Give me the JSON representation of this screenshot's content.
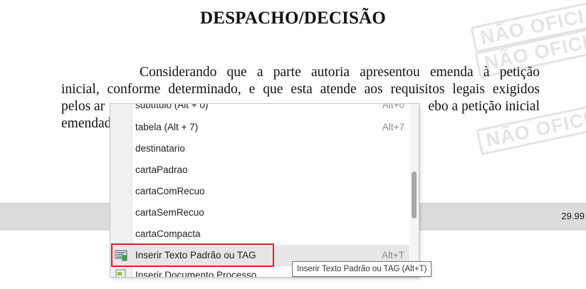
{
  "document": {
    "title": "DESPACHO/DECISÃO",
    "line1": "Considerando que a parte autoria apresentou emenda à petição",
    "line2": "inicial, conforme determinado, e que esta atende aos  requisitos legais exigidos",
    "line3_start": "pelos ar",
    "line3_end": "ebo a petição inicial",
    "line4_start": "emendad",
    "watermark": "NÃO OFICIAL"
  },
  "statusbar": {
    "zoom": "29.99"
  },
  "context_menu": {
    "items": [
      {
        "label": "subtítulo (Alt + 0)",
        "shortcut": "Alt+0"
      },
      {
        "label": "tabela (Alt + 7)",
        "shortcut": "Alt+7"
      },
      {
        "label": "destinatario",
        "shortcut": ""
      },
      {
        "label": "cartaPadrao",
        "shortcut": ""
      },
      {
        "label": "cartaComRecuo",
        "shortcut": ""
      },
      {
        "label": "cartaSemRecuo",
        "shortcut": ""
      },
      {
        "label": "cartaCompacta",
        "shortcut": ""
      },
      {
        "label": "Inserir Texto Padrão ou TAG",
        "shortcut": "Alt+T",
        "icon": "insert-text-icon"
      },
      {
        "label": "Inserir Documento Processo",
        "shortcut": "",
        "icon": "insert-document-icon"
      }
    ]
  },
  "tooltip": {
    "text": "Inserir Texto Padrão ou TAG (Alt+T)"
  },
  "colors": {
    "highlight_border": "#e0212b",
    "menu_hover": "#e6e6e6",
    "statusbar": "#dcdcdc"
  }
}
